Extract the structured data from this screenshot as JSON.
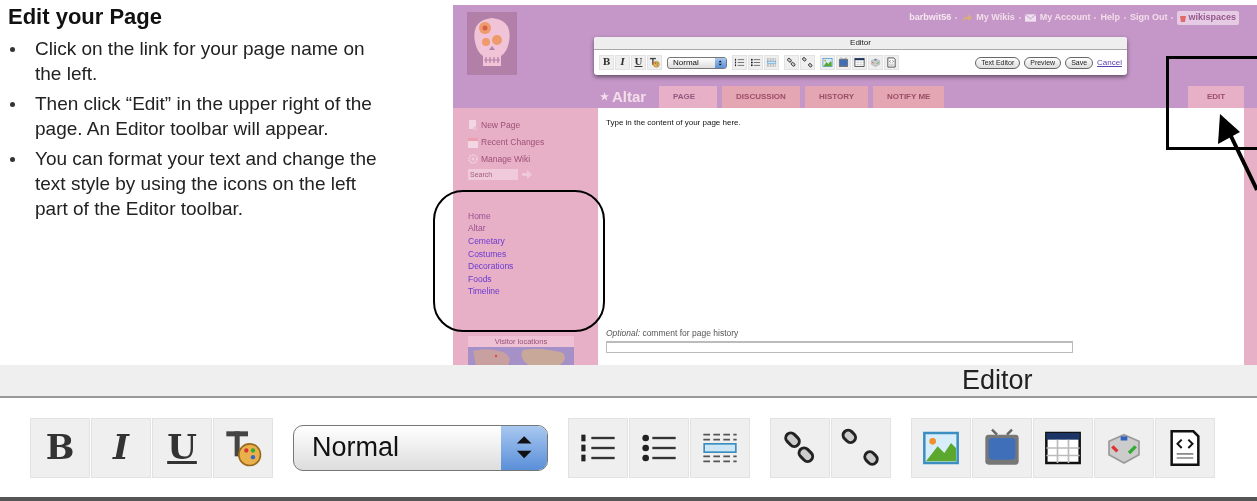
{
  "instructions": {
    "title": "Edit your Page",
    "bullets": [
      "Click on the link for your page name on the left.",
      "Then click “Edit” in the upper right of the page. An Editor toolbar will appear.",
      "You can format your text and change the text style by using the icons on the left part of the Editor toolbar."
    ]
  },
  "wiki_screenshot": {
    "user_links": [
      {
        "label": "barbwit56",
        "kind": "plain"
      },
      {
        "label": "My Wikis",
        "kind": "arrow"
      },
      {
        "label": "My Account",
        "kind": "mail"
      },
      {
        "label": "Help",
        "kind": "plain"
      },
      {
        "label": "Sign Out",
        "kind": "plain"
      },
      {
        "label": "wikispaces",
        "kind": "badge"
      }
    ],
    "editor": {
      "title": "Editor",
      "format_buttons": [
        "B",
        "I",
        "U"
      ],
      "style_value": "Normal",
      "mode_buttons": [
        "Text Editor",
        "Preview",
        "Save"
      ],
      "cancel_link": "Cancel"
    },
    "page_title": "Altar",
    "tabs": [
      {
        "label": "PAGE",
        "selected": true
      },
      {
        "label": "DISCUSSION",
        "selected": false
      },
      {
        "label": "HISTORY",
        "selected": false
      },
      {
        "label": "NOTIFY ME",
        "selected": false
      }
    ],
    "edit_tab": "EDIT",
    "sidebar": {
      "actions": [
        {
          "label": "New Page",
          "kind": "page"
        },
        {
          "label": "Recent Changes",
          "kind": "calendar"
        },
        {
          "label": "Manage Wiki",
          "kind": "gear"
        }
      ],
      "search_placeholder": "Search",
      "nav_links": [
        {
          "label": "Home",
          "visited": true
        },
        {
          "label": "Altar",
          "visited": true
        },
        {
          "label": "Cemetary",
          "visited": false
        },
        {
          "label": "Costumes",
          "visited": false
        },
        {
          "label": "Decorations",
          "visited": false
        },
        {
          "label": "Foods",
          "visited": false
        },
        {
          "label": "Timeline",
          "visited": false
        }
      ],
      "widget_title": "Visitor locations"
    },
    "editor_content": "Type in the content of your page here.",
    "comment_label": "*Optional:* comment for page history"
  },
  "zoomed_toolbar": {
    "title": "Editor",
    "format_buttons": [
      "B",
      "I",
      "U"
    ],
    "style_value": "Normal"
  }
}
